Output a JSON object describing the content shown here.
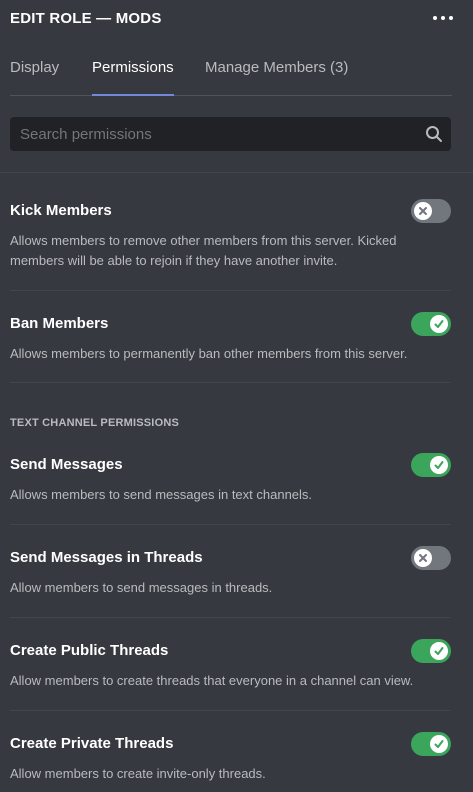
{
  "header": {
    "title": "EDIT ROLE — MODS"
  },
  "tabs": [
    {
      "label": "Display"
    },
    {
      "label": "Permissions"
    },
    {
      "label": "Manage Members (3)"
    }
  ],
  "search": {
    "placeholder": "Search permissions",
    "value": ""
  },
  "section": {
    "text_channel_label": "TEXT CHANNEL PERMISSIONS"
  },
  "permissions": [
    {
      "name": "Kick Members",
      "description": "Allows members to remove other members from this server. Kicked members will be able to rejoin if they have another invite.",
      "enabled": false
    },
    {
      "name": "Ban Members",
      "description": "Allows members to permanently ban other members from this server.",
      "enabled": true
    },
    {
      "name": "Send Messages",
      "description": "Allows members to send messages in text channels.",
      "enabled": true
    },
    {
      "name": "Send Messages in Threads",
      "description": "Allow members to send messages in threads.",
      "enabled": false
    },
    {
      "name": "Create Public Threads",
      "description": "Allow members to create threads that everyone in a channel can view.",
      "enabled": true
    },
    {
      "name": "Create Private Threads",
      "description": "Allow members to create invite-only threads.",
      "enabled": true
    }
  ],
  "colors": {
    "background": "#36393f",
    "toggle_on": "#3ba55c",
    "toggle_off": "#72767d",
    "tab_active_underline": "#7289da"
  }
}
